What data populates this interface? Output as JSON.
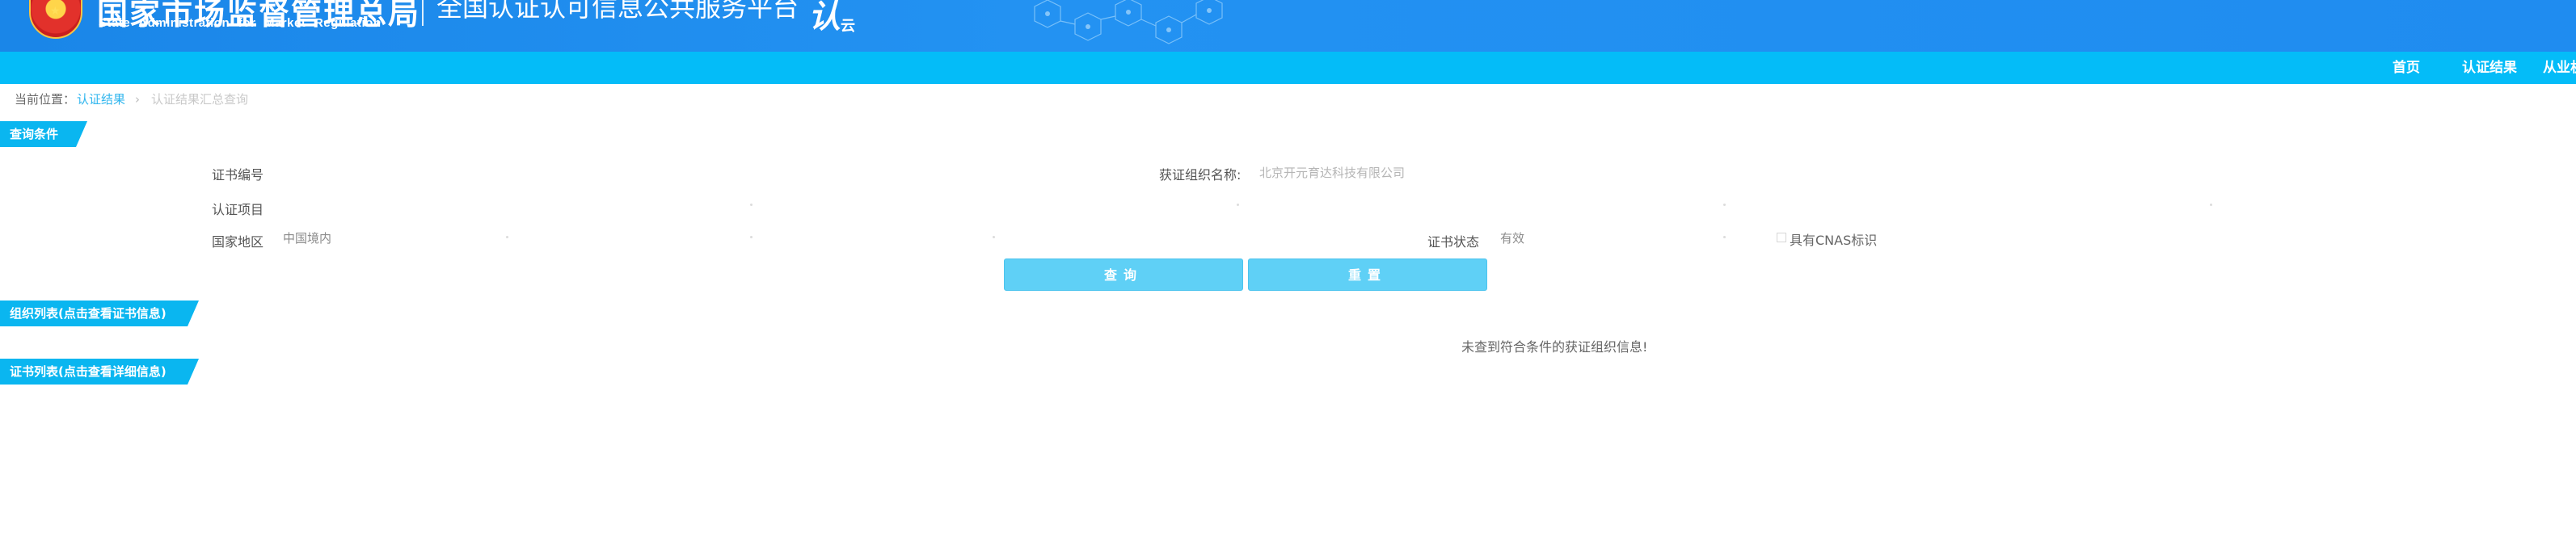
{
  "header": {
    "org_name_cn": "国家市场监督管理总局",
    "org_name_en": "State Administration for Market Regulation",
    "platform_name": "全国认证认可信息公共服务平台",
    "platform_logo": "认",
    "platform_logo_suffix": "云"
  },
  "nav": {
    "items": [
      {
        "label": "首页"
      },
      {
        "label": "认证结果"
      },
      {
        "label": "从业机"
      }
    ]
  },
  "breadcrumb": {
    "prefix": "当前位置：",
    "link": "认证结果",
    "separator": "›",
    "current": "认证结果汇总查询"
  },
  "query": {
    "section_title": "查询条件",
    "fields": {
      "cert_no_label": "证书编号",
      "org_name_label": "获证组织名称:",
      "org_name_value": "北京开元育达科技有限公司",
      "project_label": "认证项目",
      "region_label": "国家地区",
      "region_value": "中国境内",
      "status_label": "证书状态",
      "status_value": "有效",
      "cnas_label": "具有CNAS标识"
    },
    "buttons": {
      "search": "查询",
      "reset": "重置"
    }
  },
  "org_list": {
    "section_title": "组织列表(点击查看证书信息)",
    "empty_message": "未查到符合条件的获证组织信息!"
  },
  "cert_list": {
    "section_title": "证书列表(点击查看详细信息)"
  },
  "colors": {
    "header_blue": "#1f8cf0",
    "nav_cyan": "#04bcf8",
    "tab_blue": "#0ab6f0",
    "button_cyan": "#5fd0f6"
  }
}
